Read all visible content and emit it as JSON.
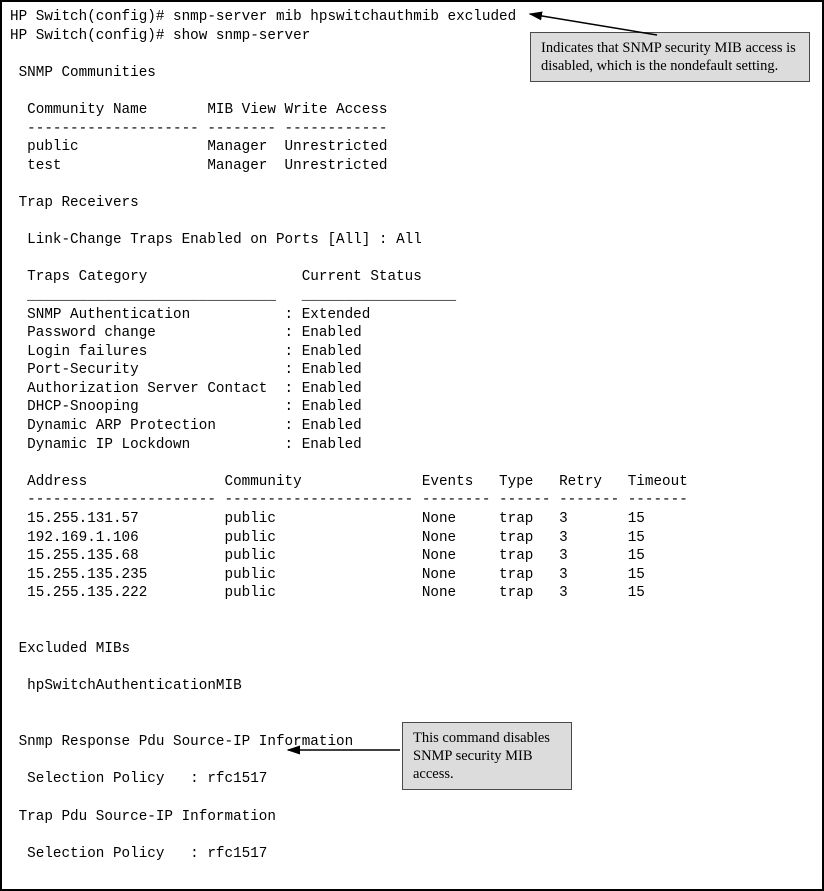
{
  "prompt": "HP Switch(config)# ",
  "cmd1": "snmp-server mib hpswitchauthmib excluded",
  "cmd2": "show snmp-server",
  "sections": {
    "communitiesHeader": " SNMP Communities",
    "communityCols": "  Community Name       MIB View Write Access",
    "communitySep": "  -------------------- -------- ------------",
    "communities": [
      "  public               Manager  Unrestricted",
      "  test                 Manager  Unrestricted"
    ],
    "trapHeader": " Trap Receivers",
    "linkChange": "  Link-Change Traps Enabled on Ports [All] : All",
    "trapsCols": "  Traps Category                  Current Status",
    "trapsSep": "  _____________________________   __________________",
    "trapsRows": [
      "  SNMP Authentication           : Extended",
      "  Password change               : Enabled",
      "  Login failures                : Enabled",
      "  Port-Security                 : Enabled",
      "  Authorization Server Contact  : Enabled",
      "  DHCP-Snooping                 : Enabled",
      "  Dynamic ARP Protection        : Enabled",
      "  Dynamic IP Lockdown           : Enabled"
    ],
    "recvCols": "  Address                Community              Events   Type   Retry   Timeout",
    "recvSep": "  ---------------------- ---------------------- -------- ------ ------- -------",
    "recvRows": [
      "  15.255.131.57          public                 None     trap   3       15",
      "  192.169.1.106          public                 None     trap   3       15",
      "  15.255.135.68          public                 None     trap   3       15",
      "  15.255.135.235         public                 None     trap   3       15",
      "  15.255.135.222         public                 None     trap   3       15"
    ],
    "excludedHeader": " Excluded MIBs",
    "excludedItem": "  hpSwitchAuthenticationMIB",
    "respHeader": " Snmp Response Pdu Source-IP Information",
    "respPolicy": "  Selection Policy   : rfc1517",
    "trapPduHeader": " Trap Pdu Source-IP Information",
    "trapPduPolicy": "  Selection Policy   : rfc1517"
  },
  "callouts": {
    "c1": "Indicates that SNMP security MIB access is disabled, which is the nondefault setting.",
    "c2": "This command disables SNMP security MIB access."
  }
}
